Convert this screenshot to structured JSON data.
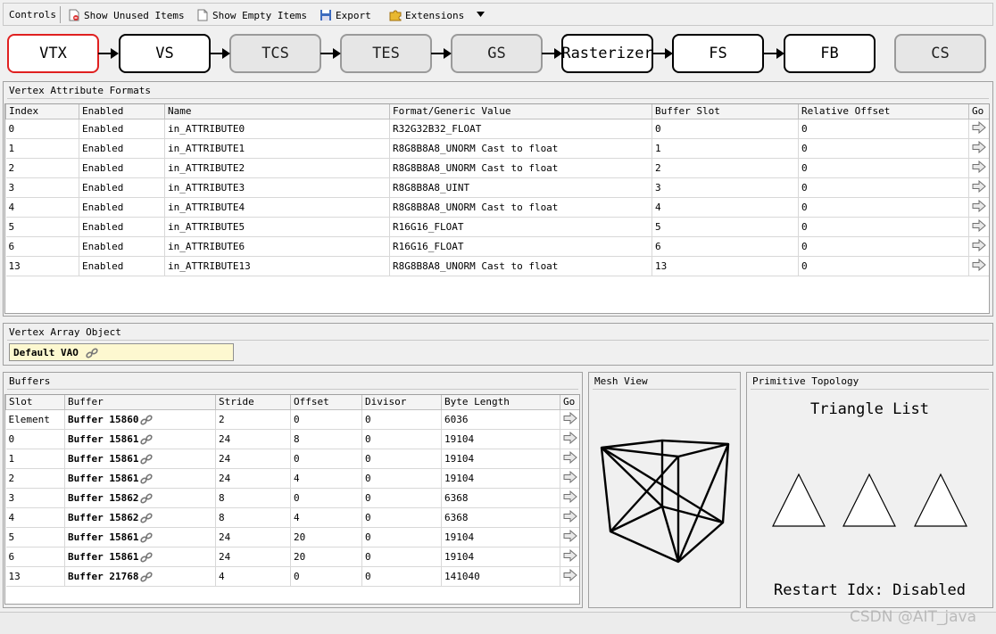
{
  "toolbar": {
    "controls_label": "Controls",
    "show_unused": "Show Unused Items",
    "show_empty": "Show Empty Items",
    "export": "Export",
    "extensions": "Extensions"
  },
  "pipeline": {
    "stages": [
      "VTX",
      "VS",
      "TCS",
      "TES",
      "GS",
      "Rasterizer",
      "FS",
      "FB",
      "CS"
    ],
    "selected": "VTX"
  },
  "vertex_attributes": {
    "title": "Vertex Attribute Formats",
    "columns": [
      "Index",
      "Enabled",
      "Name",
      "Format/Generic Value",
      "Buffer Slot",
      "Relative Offset",
      "Go"
    ],
    "rows": [
      [
        "0",
        "Enabled",
        "in_ATTRIBUTE0",
        "R32G32B32_FLOAT",
        "0",
        "0"
      ],
      [
        "1",
        "Enabled",
        "in_ATTRIBUTE1",
        "R8G8B8A8_UNORM Cast to float",
        "1",
        "0"
      ],
      [
        "2",
        "Enabled",
        "in_ATTRIBUTE2",
        "R8G8B8A8_UNORM Cast to float",
        "2",
        "0"
      ],
      [
        "3",
        "Enabled",
        "in_ATTRIBUTE3",
        "R8G8B8A8_UINT",
        "3",
        "0"
      ],
      [
        "4",
        "Enabled",
        "in_ATTRIBUTE4",
        "R8G8B8A8_UNORM Cast to float",
        "4",
        "0"
      ],
      [
        "5",
        "Enabled",
        "in_ATTRIBUTE5",
        "R16G16_FLOAT",
        "5",
        "0"
      ],
      [
        "6",
        "Enabled",
        "in_ATTRIBUTE6",
        "R16G16_FLOAT",
        "6",
        "0"
      ],
      [
        "13",
        "Enabled",
        "in_ATTRIBUTE13",
        "R8G8B8A8_UNORM Cast to float",
        "13",
        "0"
      ]
    ]
  },
  "vao": {
    "title": "Vertex Array Object",
    "value": "Default VAO"
  },
  "buffers": {
    "title": "Buffers",
    "columns": [
      "Slot",
      "Buffer",
      "Stride",
      "Offset",
      "Divisor",
      "Byte Length",
      "Go"
    ],
    "rows": [
      [
        "Element",
        "Buffer 15860",
        "2",
        "0",
        "0",
        "6036"
      ],
      [
        "0",
        "Buffer 15861",
        "24",
        "8",
        "0",
        "19104"
      ],
      [
        "1",
        "Buffer 15861",
        "24",
        "0",
        "0",
        "19104"
      ],
      [
        "2",
        "Buffer 15861",
        "24",
        "4",
        "0",
        "19104"
      ],
      [
        "3",
        "Buffer 15862",
        "8",
        "0",
        "0",
        "6368"
      ],
      [
        "4",
        "Buffer 15862",
        "8",
        "4",
        "0",
        "6368"
      ],
      [
        "5",
        "Buffer 15861",
        "24",
        "20",
        "0",
        "19104"
      ],
      [
        "6",
        "Buffer 15861",
        "24",
        "20",
        "0",
        "19104"
      ],
      [
        "13",
        "Buffer 21768",
        "4",
        "0",
        "0",
        "141040"
      ]
    ]
  },
  "mesh_view": {
    "title": "Mesh View"
  },
  "topology": {
    "title": "Primitive Topology",
    "value": "Triangle List",
    "restart": "Restart Idx: Disabled"
  },
  "watermark": "CSDN @AIT_java",
  "colors": {
    "selected_stage_border": "#e02020",
    "vao_field_bg": "#fdf8d0"
  }
}
